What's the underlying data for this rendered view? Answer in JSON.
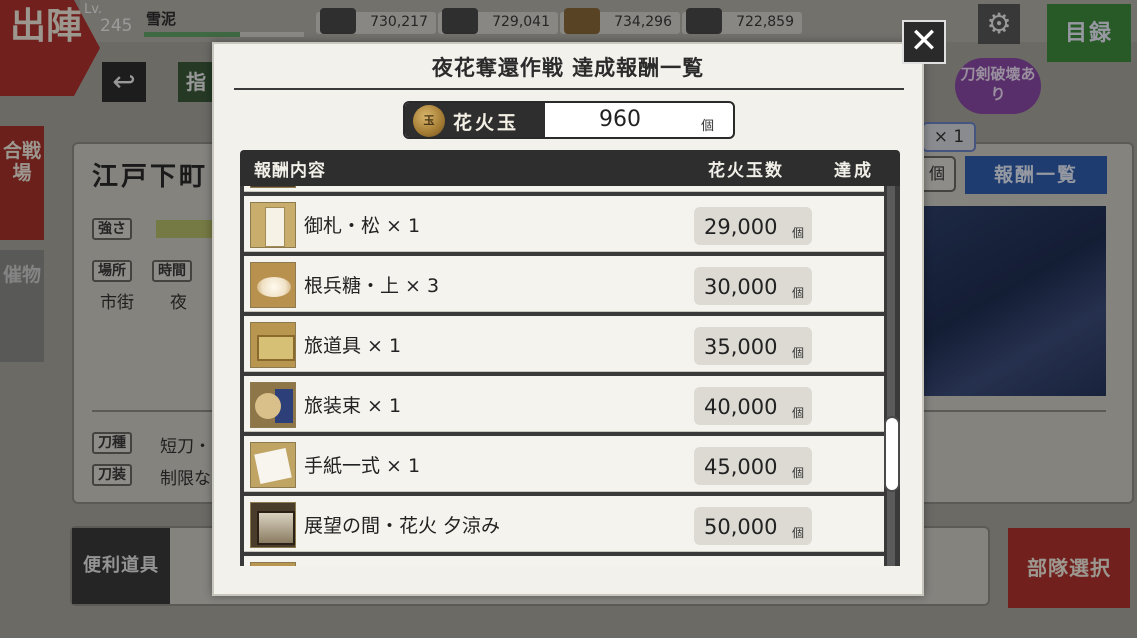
{
  "background": {
    "shutsujin_label": "出陣",
    "level_label": "Lv.",
    "level_value": "245",
    "user_name": "雪泥",
    "exp_fraction": 0.6,
    "resources": [
      "730,217",
      "729,041",
      "734,296",
      "722,859"
    ],
    "mokuroku_label": "目録",
    "side_tabs": [
      "合戦場",
      "催物"
    ],
    "stage_title": "江戸下町",
    "tags": {
      "strength": "強さ",
      "place": "場所",
      "time": "時間",
      "katana_type": "刀種",
      "katana_equip": "刀装"
    },
    "place_value": "市街",
    "time_value": "夜",
    "katana_type_value": "短刀・",
    "katana_equip_value": "制限な",
    "hakai_label": "刀剣破壊あり",
    "pill_x1": "× 1",
    "pill_ko": "個",
    "hoshu_button": "報酬一覧",
    "benri_label": "便利道具",
    "butai_button": "部隊選択",
    "partial_button_label": "指"
  },
  "modal": {
    "title": "夜花奪還作戦 達成報酬一覧",
    "close_icon": "close-icon",
    "counter": {
      "label": "花火玉",
      "value": "960",
      "unit": "個"
    },
    "columns": {
      "content": "報酬内容",
      "count": "花火玉数",
      "done": "達成"
    },
    "unit": "個",
    "rows": [
      {
        "name": "御札・松 × 1",
        "amount": "29,000",
        "thumb": "ofuda"
      },
      {
        "name": "根兵糖・上 × 3",
        "amount": "30,000",
        "thumb": "konpeito"
      },
      {
        "name": "旅道具 × 1",
        "amount": "35,000",
        "thumb": "tabidougu"
      },
      {
        "name": "旅装束 × 1",
        "amount": "40,000",
        "thumb": "tabishozoku"
      },
      {
        "name": "手紙一式 × 1",
        "amount": "45,000",
        "thumb": "tegami"
      },
      {
        "name": "展望の間・花火 夕涼み",
        "amount": "50,000",
        "thumb": "tenbo"
      }
    ]
  },
  "colors": {
    "accent_red": "#b1322e",
    "accent_green": "#3f8d3e",
    "accent_blue": "#2f5fb0",
    "dark": "#2e2e2e"
  }
}
